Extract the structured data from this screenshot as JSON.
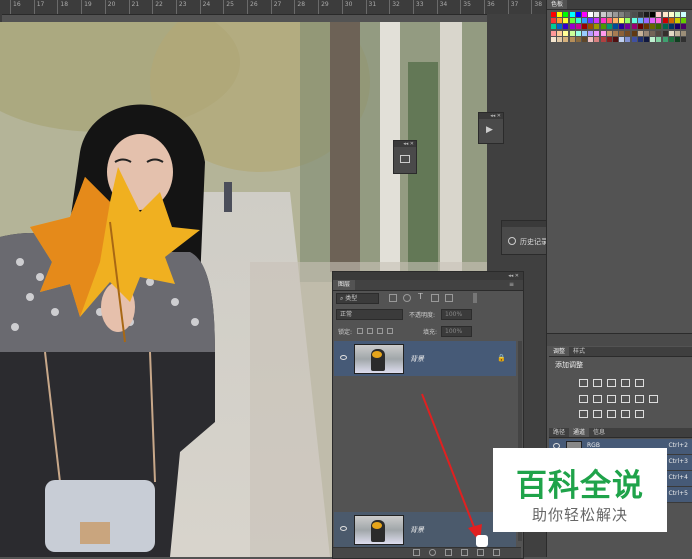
{
  "ruler": {
    "ticks": [
      "16",
      "17",
      "18",
      "19",
      "20",
      "21",
      "22",
      "23",
      "24",
      "25",
      "26",
      "27",
      "28",
      "29",
      "30",
      "31",
      "32",
      "33",
      "34",
      "35",
      "36",
      "37",
      "38"
    ]
  },
  "swatches_panel": {
    "tab": "色板"
  },
  "history_panel": {
    "label": "历史记录"
  },
  "layers_panel": {
    "tab": "图层",
    "filter_kind": "类型",
    "blend_mode": "正常",
    "opacity_label": "不透明度:",
    "opacity_value": "100%",
    "lock_label": "锁定:",
    "fill_label": "填充:",
    "fill_value": "100%",
    "layers": [
      {
        "name": "背景"
      },
      {
        "name": "背景"
      }
    ]
  },
  "adjustments_panel": {
    "tabs": [
      "调整",
      "样式"
    ],
    "title": "添加调整"
  },
  "channels_panel": {
    "tabs": [
      "路径",
      "通道",
      "信息"
    ],
    "channels": [
      {
        "name": "RGB",
        "shortcut": "Ctrl+2"
      },
      {
        "name": "",
        "shortcut": "Ctrl+3"
      },
      {
        "name": "",
        "shortcut": "Ctrl+4"
      },
      {
        "name": "",
        "shortcut": "Ctrl+5"
      }
    ]
  },
  "watermark": {
    "title": "百科全说",
    "subtitle": "助你轻松解决"
  },
  "colors": {
    "ps_bg": "#535353",
    "selected_layer": "#465a77",
    "watermark_green": "#1fa34a",
    "arrow": "#e02020"
  }
}
